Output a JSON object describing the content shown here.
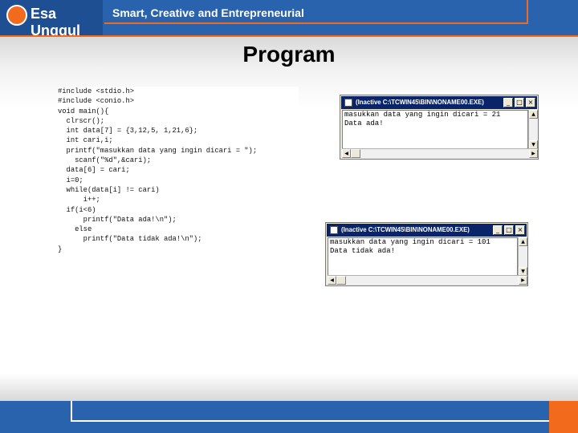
{
  "header": {
    "logo_text": "Esa Unggul",
    "tagline": "Smart, Creative and Entrepreneurial",
    "colors": {
      "brand_blue": "#2a63ad",
      "brand_orange": "#f26b1d"
    }
  },
  "slide": {
    "title": "Program"
  },
  "code": {
    "lines": [
      "#include <stdio.h>",
      "#include <conio.h>",
      "void main(){",
      "  clrscr();",
      "  int data[7] = {3,12,5, 1,21,6};",
      "  int cari,i;",
      "  printf(\"masukkan data yang ingin dicari = \");",
      "    scanf(\"%d\",&cari);",
      "  data[6] = cari;",
      "  i=0;",
      "  while(data[i] != cari)",
      "      i++;",
      "  if(i<6)",
      "      printf(\"Data ada!\\n\");",
      "    else",
      "      printf(\"Data tidak ada!\\n\");",
      "}"
    ]
  },
  "console1": {
    "title": "(Inactive C:\\TCWIN45\\BIN\\NONAME00.EXE)",
    "output": [
      "masukkan data yang ingin dicari = 21",
      "Data ada!"
    ],
    "minimize": "_",
    "maximize": "□",
    "close": "×"
  },
  "console2": {
    "title": "(Inactive C:\\TCWIN45\\BIN\\NONAME00.EXE)",
    "output": [
      "masukkan data yang ingin dicari = 101",
      "Data tidak ada!"
    ],
    "minimize": "_",
    "maximize": "□",
    "close": "×"
  }
}
